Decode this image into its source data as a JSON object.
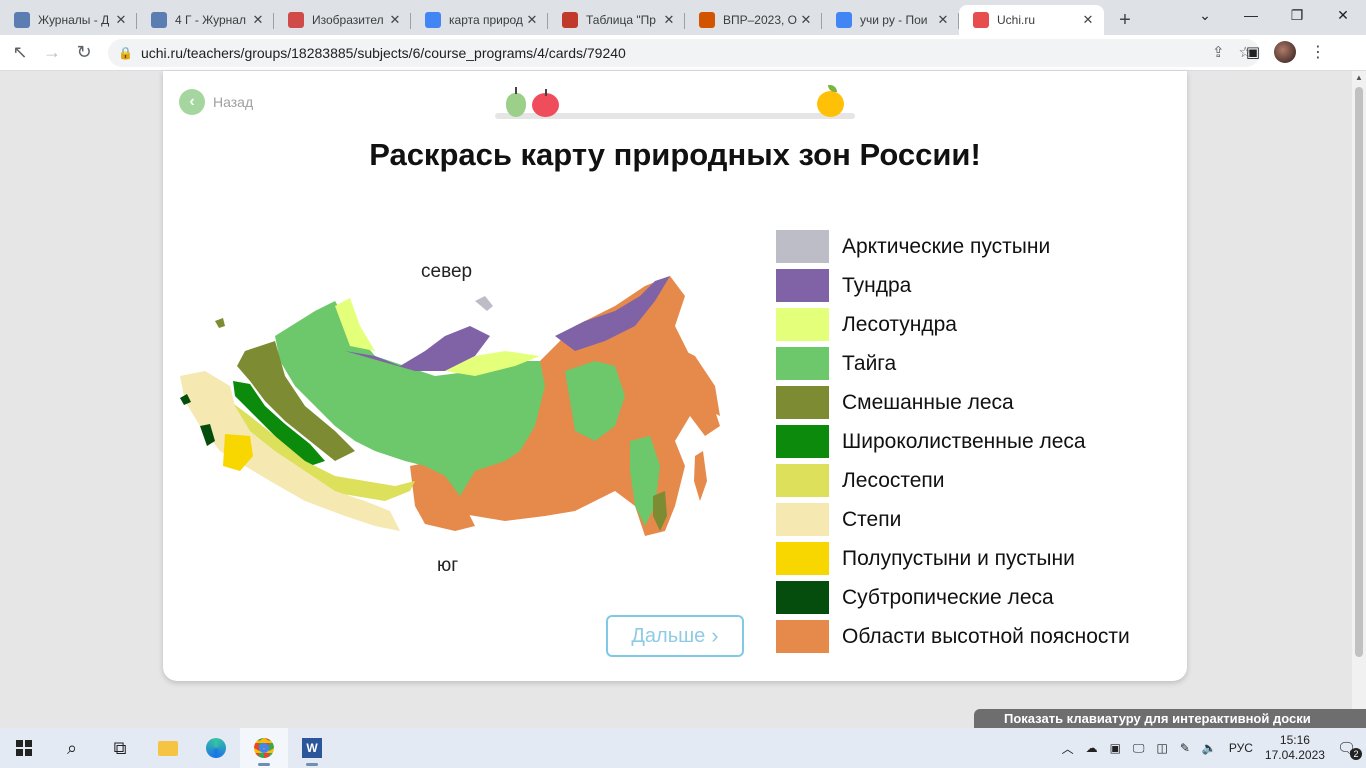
{
  "browser": {
    "tabs": [
      {
        "label": "Журналы - Д",
        "icon": "vk-icon",
        "color": "#5b7db1"
      },
      {
        "label": "4 Г - Журнал",
        "icon": "vk-icon",
        "color": "#5b7db1"
      },
      {
        "label": "Изобразител",
        "icon": "edu-icon",
        "color": "#d04a4a"
      },
      {
        "label": "карта природ",
        "icon": "google-icon",
        "color": "#4285f4"
      },
      {
        "label": "Таблица \"Пр",
        "icon": "book-icon",
        "color": "#c0392b"
      },
      {
        "label": "ВПР–2023, О",
        "icon": "vpr-icon",
        "color": "#d35400"
      },
      {
        "label": "учи ру - Пои",
        "icon": "google-icon",
        "color": "#4285f4"
      },
      {
        "label": "Uchi.ru",
        "icon": "uchi-icon",
        "color": "#e84d4d",
        "active": true
      }
    ],
    "url": "uchi.ru/teachers/groups/18283885/subjects/6/course_programs/4/cards/79240"
  },
  "card": {
    "back_label": "Назад",
    "title": "Раскрась карту природных зон России!",
    "north_label": "север",
    "south_label": "юг",
    "next_label": "Дальше",
    "legend": [
      {
        "label": "Арктические пустыни",
        "color": "#bdbdc7"
      },
      {
        "label": "Тундра",
        "color": "#7f63a6"
      },
      {
        "label": "Лесотундра",
        "color": "#e4ff7a"
      },
      {
        "label": "Тайга",
        "color": "#6cc86a"
      },
      {
        "label": "Смешанные леса",
        "color": "#7d8b33"
      },
      {
        "label": "Широколиственные леса",
        "color": "#0b8a0b"
      },
      {
        "label": "Лесостепи",
        "color": "#dce05a"
      },
      {
        "label": "Степи",
        "color": "#f5e8b0"
      },
      {
        "label": "Полупустыни и пустыни",
        "color": "#f8d700"
      },
      {
        "label": "Субтропические леса",
        "color": "#054d0c"
      },
      {
        "label": "Области высотной поясности",
        "color": "#e68a4c"
      }
    ]
  },
  "keyboard_banner": "Показать клавиатуру для интерактивной доски",
  "taskbar": {
    "lang": "РУС",
    "time": "15:16",
    "date": "17.04.2023",
    "notifications": "2"
  }
}
